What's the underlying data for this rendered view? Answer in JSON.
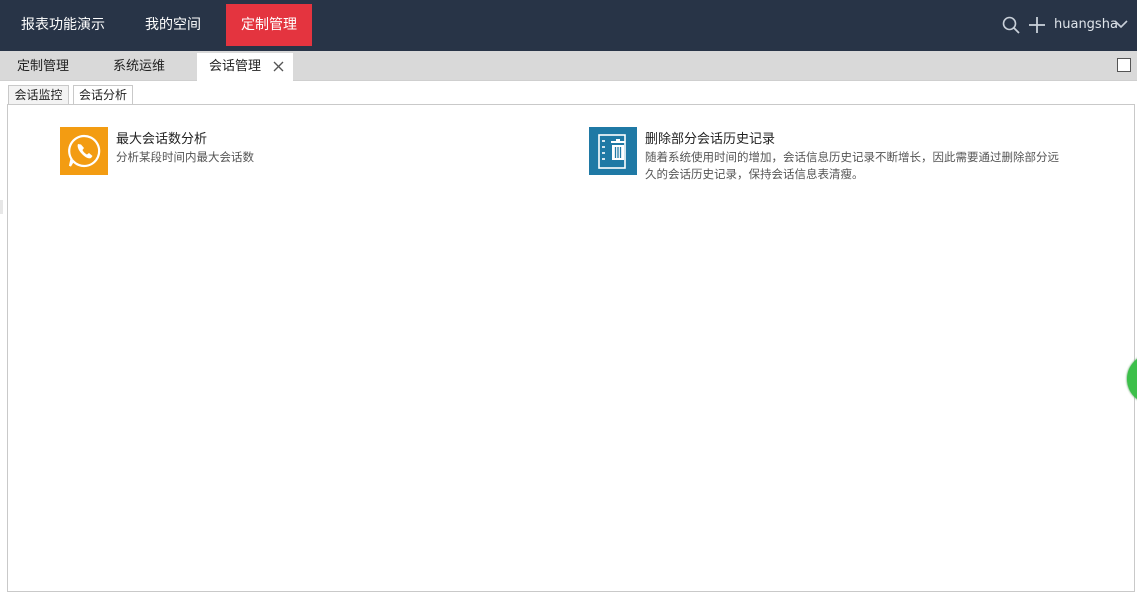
{
  "topnav": {
    "items": [
      {
        "label": "报表功能演示"
      },
      {
        "label": "我的空间"
      },
      {
        "label": "定制管理",
        "active": true
      }
    ],
    "username": "huangsha",
    "active_color": "#e4343f",
    "bar_color": "#283447"
  },
  "tabs": [
    {
      "label": "定制管理"
    },
    {
      "label": "系统运维"
    },
    {
      "label": "会话管理",
      "active": true,
      "closable": true
    }
  ],
  "subtabs": [
    {
      "label": "会话监控"
    },
    {
      "label": "会话分析",
      "active": true
    }
  ],
  "cards": [
    {
      "title": "最大会话数分析",
      "description": "分析某段时间内最大会话数",
      "icon": "phone-chat-icon",
      "icon_color": "#f39c12"
    },
    {
      "title": "删除部分会话历史记录",
      "description_lines": [
        "随着系统使用时间的增加，会话信息历史记录不断增长，因此需要通过删除部分远",
        "久的会话历史记录，保持会话信息表清瘦。"
      ],
      "icon": "trash-list-icon",
      "icon_color": "#1f79a5"
    }
  ]
}
